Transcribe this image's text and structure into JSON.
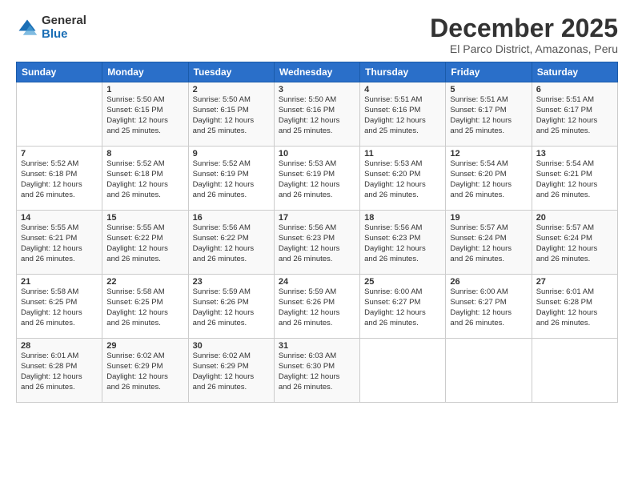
{
  "logo": {
    "general": "General",
    "blue": "Blue"
  },
  "title": "December 2025",
  "subtitle": "El Parco District, Amazonas, Peru",
  "days_of_week": [
    "Sunday",
    "Monday",
    "Tuesday",
    "Wednesday",
    "Thursday",
    "Friday",
    "Saturday"
  ],
  "weeks": [
    [
      {
        "day": "",
        "info": ""
      },
      {
        "day": "1",
        "info": "Sunrise: 5:50 AM\nSunset: 6:15 PM\nDaylight: 12 hours\nand 25 minutes."
      },
      {
        "day": "2",
        "info": "Sunrise: 5:50 AM\nSunset: 6:15 PM\nDaylight: 12 hours\nand 25 minutes."
      },
      {
        "day": "3",
        "info": "Sunrise: 5:50 AM\nSunset: 6:16 PM\nDaylight: 12 hours\nand 25 minutes."
      },
      {
        "day": "4",
        "info": "Sunrise: 5:51 AM\nSunset: 6:16 PM\nDaylight: 12 hours\nand 25 minutes."
      },
      {
        "day": "5",
        "info": "Sunrise: 5:51 AM\nSunset: 6:17 PM\nDaylight: 12 hours\nand 25 minutes."
      },
      {
        "day": "6",
        "info": "Sunrise: 5:51 AM\nSunset: 6:17 PM\nDaylight: 12 hours\nand 25 minutes."
      }
    ],
    [
      {
        "day": "7",
        "info": "Sunrise: 5:52 AM\nSunset: 6:18 PM\nDaylight: 12 hours\nand 26 minutes."
      },
      {
        "day": "8",
        "info": "Sunrise: 5:52 AM\nSunset: 6:18 PM\nDaylight: 12 hours\nand 26 minutes."
      },
      {
        "day": "9",
        "info": "Sunrise: 5:52 AM\nSunset: 6:19 PM\nDaylight: 12 hours\nand 26 minutes."
      },
      {
        "day": "10",
        "info": "Sunrise: 5:53 AM\nSunset: 6:19 PM\nDaylight: 12 hours\nand 26 minutes."
      },
      {
        "day": "11",
        "info": "Sunrise: 5:53 AM\nSunset: 6:20 PM\nDaylight: 12 hours\nand 26 minutes."
      },
      {
        "day": "12",
        "info": "Sunrise: 5:54 AM\nSunset: 6:20 PM\nDaylight: 12 hours\nand 26 minutes."
      },
      {
        "day": "13",
        "info": "Sunrise: 5:54 AM\nSunset: 6:21 PM\nDaylight: 12 hours\nand 26 minutes."
      }
    ],
    [
      {
        "day": "14",
        "info": "Sunrise: 5:55 AM\nSunset: 6:21 PM\nDaylight: 12 hours\nand 26 minutes."
      },
      {
        "day": "15",
        "info": "Sunrise: 5:55 AM\nSunset: 6:22 PM\nDaylight: 12 hours\nand 26 minutes."
      },
      {
        "day": "16",
        "info": "Sunrise: 5:56 AM\nSunset: 6:22 PM\nDaylight: 12 hours\nand 26 minutes."
      },
      {
        "day": "17",
        "info": "Sunrise: 5:56 AM\nSunset: 6:23 PM\nDaylight: 12 hours\nand 26 minutes."
      },
      {
        "day": "18",
        "info": "Sunrise: 5:56 AM\nSunset: 6:23 PM\nDaylight: 12 hours\nand 26 minutes."
      },
      {
        "day": "19",
        "info": "Sunrise: 5:57 AM\nSunset: 6:24 PM\nDaylight: 12 hours\nand 26 minutes."
      },
      {
        "day": "20",
        "info": "Sunrise: 5:57 AM\nSunset: 6:24 PM\nDaylight: 12 hours\nand 26 minutes."
      }
    ],
    [
      {
        "day": "21",
        "info": "Sunrise: 5:58 AM\nSunset: 6:25 PM\nDaylight: 12 hours\nand 26 minutes."
      },
      {
        "day": "22",
        "info": "Sunrise: 5:58 AM\nSunset: 6:25 PM\nDaylight: 12 hours\nand 26 minutes."
      },
      {
        "day": "23",
        "info": "Sunrise: 5:59 AM\nSunset: 6:26 PM\nDaylight: 12 hours\nand 26 minutes."
      },
      {
        "day": "24",
        "info": "Sunrise: 5:59 AM\nSunset: 6:26 PM\nDaylight: 12 hours\nand 26 minutes."
      },
      {
        "day": "25",
        "info": "Sunrise: 6:00 AM\nSunset: 6:27 PM\nDaylight: 12 hours\nand 26 minutes."
      },
      {
        "day": "26",
        "info": "Sunrise: 6:00 AM\nSunset: 6:27 PM\nDaylight: 12 hours\nand 26 minutes."
      },
      {
        "day": "27",
        "info": "Sunrise: 6:01 AM\nSunset: 6:28 PM\nDaylight: 12 hours\nand 26 minutes."
      }
    ],
    [
      {
        "day": "28",
        "info": "Sunrise: 6:01 AM\nSunset: 6:28 PM\nDaylight: 12 hours\nand 26 minutes."
      },
      {
        "day": "29",
        "info": "Sunrise: 6:02 AM\nSunset: 6:29 PM\nDaylight: 12 hours\nand 26 minutes."
      },
      {
        "day": "30",
        "info": "Sunrise: 6:02 AM\nSunset: 6:29 PM\nDaylight: 12 hours\nand 26 minutes."
      },
      {
        "day": "31",
        "info": "Sunrise: 6:03 AM\nSunset: 6:30 PM\nDaylight: 12 hours\nand 26 minutes."
      },
      {
        "day": "",
        "info": ""
      },
      {
        "day": "",
        "info": ""
      },
      {
        "day": "",
        "info": ""
      }
    ]
  ]
}
